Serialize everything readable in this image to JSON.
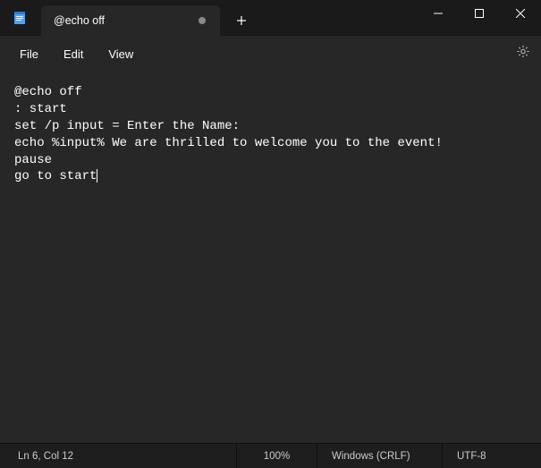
{
  "titlebar": {
    "tab_title": "@echo off"
  },
  "menubar": {
    "file": "File",
    "edit": "Edit",
    "view": "View"
  },
  "editor": {
    "content": "@echo off\n: start\nset /p input = Enter the Name:\necho %input% We are thrilled to welcome you to the event!\npause\ngo to start"
  },
  "statusbar": {
    "position": "Ln 6, Col 12",
    "zoom": "100%",
    "eol": "Windows (CRLF)",
    "encoding": "UTF-8"
  }
}
